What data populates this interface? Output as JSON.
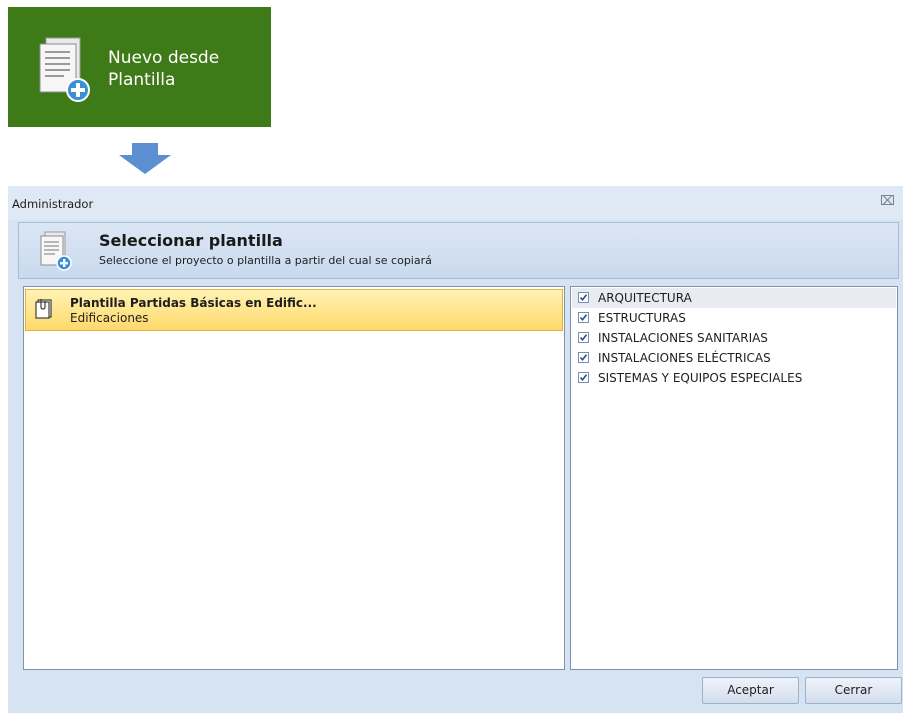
{
  "ribbon": {
    "button_line1": "Nuevo desde",
    "button_line2": "Plantilla",
    "icon": "new-from-template-icon",
    "background": "#3f7a19"
  },
  "arrow": {
    "icon": "down-arrow-icon",
    "color": "#5b8fd1"
  },
  "dialog": {
    "title": "Administrador",
    "close_icon": "close-icon",
    "header": {
      "title": "Seleccionar plantilla",
      "subtitle": "Seleccione el proyecto o plantilla a partir del cual se copiará"
    },
    "templates": [
      {
        "name": "Plantilla Partidas Básicas en Edific...",
        "category": "Edificaciones",
        "icon": "clipboard-icon"
      }
    ],
    "categories": [
      {
        "label": "ARQUITECTURA",
        "checked": true
      },
      {
        "label": "ESTRUCTURAS",
        "checked": true
      },
      {
        "label": "INSTALACIONES SANITARIAS",
        "checked": true
      },
      {
        "label": "INSTALACIONES ELÉCTRICAS",
        "checked": true
      },
      {
        "label": "SISTEMAS Y EQUIPOS ESPECIALES",
        "checked": true
      }
    ],
    "buttons": {
      "accept": "Aceptar",
      "close": "Cerrar"
    }
  }
}
